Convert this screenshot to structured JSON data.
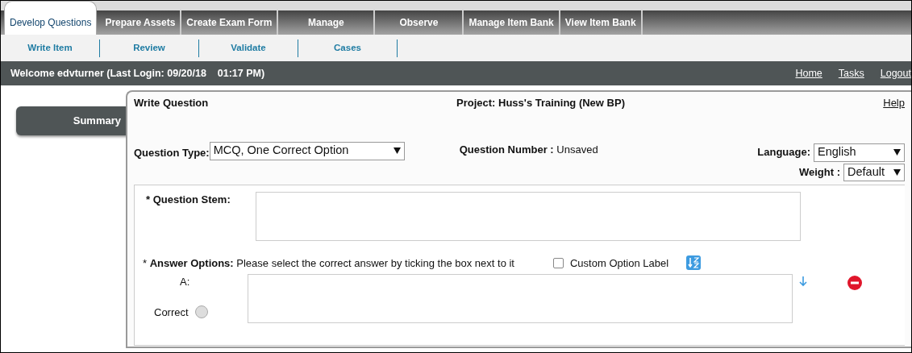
{
  "main_tabs": [
    {
      "label": "Develop Questions",
      "selected": true
    },
    {
      "label": "Prepare Assets",
      "selected": false
    },
    {
      "label": "Create Exam Form",
      "selected": false
    },
    {
      "label": "Manage",
      "selected": false
    },
    {
      "label": "Observe",
      "selected": false
    },
    {
      "label": "Manage Item Bank",
      "selected": false
    },
    {
      "label": "View Item Bank",
      "selected": false
    }
  ],
  "sub_tabs": [
    "Write Item",
    "Review",
    "Validate",
    "Cases"
  ],
  "welcome": {
    "text": "Welcome edvturner (Last Login: 09/20/18    01:17 PM)",
    "links": [
      "Home",
      "Tasks",
      "Logout"
    ]
  },
  "sidebar": {
    "items": [
      "Summary"
    ]
  },
  "panel": {
    "title": "Write Question",
    "project": "Project: Huss's Training (New BP)",
    "help": "Help",
    "question_type": {
      "label": "Question Type:",
      "value": "MCQ, One Correct Option"
    },
    "question_number": {
      "label": "Question Number :",
      "value": "Unsaved"
    },
    "language": {
      "label": "Language:",
      "value": "English"
    },
    "weight": {
      "label": "Weight :",
      "value": "Default"
    },
    "stem": {
      "label": "* Question Stem:"
    },
    "answer_options": {
      "label": "* **Answer Options:** Please select the correct answer by ticking the box next to it",
      "custom_label": {
        "label": "Custom Option Label",
        "checked": false
      },
      "options": [
        {
          "letter": "A:",
          "correct_label": "Correct",
          "selected": false
        }
      ]
    }
  }
}
